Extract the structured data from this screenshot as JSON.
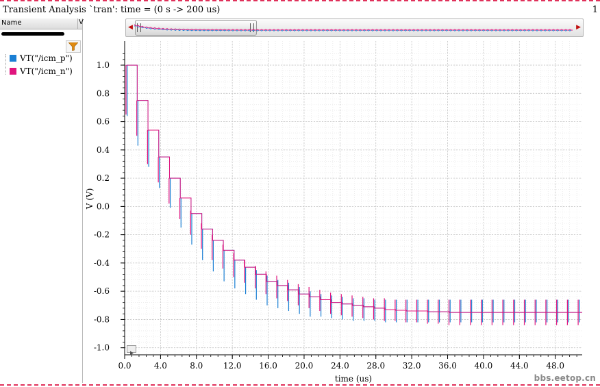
{
  "window": {
    "title": "Transient Analysis `tran': time = (0 s -> 200 us)",
    "page_number": "1"
  },
  "panel": {
    "header_name": "Name",
    "header_col2": "V"
  },
  "icons": {
    "filter": "filter-funnel-icon",
    "play": "play-triangle-icon"
  },
  "watermark": "bbs.eetop.cn",
  "colors": {
    "series_p": "#1a7fd4",
    "series_n": "#e0147e",
    "grid": "#c9c9c9",
    "border_dash": "#e0305a"
  },
  "chart_data": {
    "type": "line",
    "xlabel": "time (us)",
    "ylabel": "V (V)",
    "xlim": [
      0,
      51
    ],
    "ylim": [
      -1.05,
      1.17
    ],
    "xticks": [
      "0.0",
      "4.0",
      "8.0",
      "12.0",
      "16.0",
      "20.0",
      "24.0",
      "28.0",
      "32.0",
      "36.0",
      "40.0",
      "44.0",
      "48.0"
    ],
    "yticks": [
      "1.0",
      "0.8",
      "0.6",
      "0.4",
      "0.2",
      "0.0",
      "-0.2",
      "-0.4",
      "-0.6",
      "-0.8",
      "-1.0"
    ],
    "grid": true,
    "legend_position": "left-panel",
    "step_period_us": 1.2,
    "steady_state_v": -0.75,
    "series": [
      {
        "name": "VT(\"/icm_p\")",
        "color": "#1a7fd4",
        "x": [
          0.2,
          1.4,
          2.6,
          3.8,
          5.0,
          6.2,
          7.4,
          8.6,
          9.8,
          11.0,
          12.2,
          13.4,
          14.6,
          15.8,
          17.0,
          18.2,
          19.4,
          20.6,
          21.8,
          23.0,
          24.2,
          25.4,
          26.6,
          27.8,
          29.0,
          30.2,
          31.4,
          32.6,
          33.8,
          35.0,
          36.2,
          37.4,
          38.6,
          39.8,
          41.0,
          42.2,
          43.4,
          44.6,
          45.8,
          47.0,
          48.2,
          49.4,
          50.6
        ],
        "y": [
          1.0,
          0.75,
          0.54,
          0.35,
          0.2,
          0.06,
          -0.05,
          -0.16,
          -0.24,
          -0.31,
          -0.38,
          -0.43,
          -0.48,
          -0.53,
          -0.56,
          -0.59,
          -0.62,
          -0.64,
          -0.66,
          -0.68,
          -0.69,
          -0.7,
          -0.71,
          -0.72,
          -0.73,
          -0.735,
          -0.74,
          -0.74,
          -0.745,
          -0.745,
          -0.75,
          -0.75,
          -0.75,
          -0.75,
          -0.75,
          -0.75,
          -0.75,
          -0.75,
          -0.75,
          -0.75,
          -0.75,
          -0.75,
          -0.75
        ],
        "spike_low": [
          0.64,
          0.43,
          0.28,
          0.13,
          -0.01,
          -0.15,
          -0.27,
          -0.38,
          -0.46,
          -0.53,
          -0.58,
          -0.62,
          -0.66,
          -0.7,
          -0.72,
          -0.74,
          -0.76,
          -0.78,
          -0.78,
          -0.79,
          -0.8,
          -0.81,
          -0.81,
          -0.81,
          -0.82,
          -0.82,
          -0.82,
          -0.82,
          -0.82,
          -0.82,
          -0.82,
          -0.82,
          -0.82,
          -0.82,
          -0.82,
          -0.82,
          -0.82,
          -0.82,
          -0.82,
          -0.82,
          -0.82,
          -0.82,
          -0.82
        ],
        "spike_high": [
          1.0,
          0.75,
          0.54,
          0.35,
          0.2,
          0.06,
          -0.05,
          -0.16,
          -0.24,
          -0.31,
          -0.38,
          -0.43,
          -0.45,
          -0.49,
          -0.52,
          -0.54,
          -0.57,
          -0.6,
          -0.62,
          -0.63,
          -0.64,
          -0.65,
          -0.65,
          -0.66,
          -0.66,
          -0.66,
          -0.66,
          -0.66,
          -0.66,
          -0.66,
          -0.66,
          -0.66,
          -0.66,
          -0.66,
          -0.66,
          -0.66,
          -0.66,
          -0.66,
          -0.66,
          -0.66,
          -0.66,
          -0.66,
          -0.66
        ]
      },
      {
        "name": "VT(\"/icm_n\")",
        "color": "#e0147e",
        "x": [
          0.2,
          1.4,
          2.6,
          3.8,
          5.0,
          6.2,
          7.4,
          8.6,
          9.8,
          11.0,
          12.2,
          13.4,
          14.6,
          15.8,
          17.0,
          18.2,
          19.4,
          20.6,
          21.8,
          23.0,
          24.2,
          25.4,
          26.6,
          27.8,
          29.0,
          30.2,
          31.4,
          32.6,
          33.8,
          35.0,
          36.2,
          37.4,
          38.6,
          39.8,
          41.0,
          42.2,
          43.4,
          44.6,
          45.8,
          47.0,
          48.2,
          49.4,
          50.6
        ],
        "y": [
          1.0,
          0.75,
          0.54,
          0.35,
          0.2,
          0.06,
          -0.05,
          -0.16,
          -0.24,
          -0.31,
          -0.38,
          -0.43,
          -0.48,
          -0.53,
          -0.56,
          -0.59,
          -0.62,
          -0.64,
          -0.66,
          -0.68,
          -0.69,
          -0.7,
          -0.71,
          -0.72,
          -0.73,
          -0.735,
          -0.74,
          -0.74,
          -0.745,
          -0.745,
          -0.75,
          -0.75,
          -0.75,
          -0.75,
          -0.75,
          -0.75,
          -0.75,
          -0.75,
          -0.75,
          -0.75,
          -0.75,
          -0.75,
          -0.75
        ],
        "spike_low": [
          0.65,
          0.5,
          0.3,
          0.17,
          0.02,
          -0.09,
          -0.2,
          -0.3,
          -0.38,
          -0.44,
          -0.5,
          -0.54,
          -0.58,
          -0.62,
          -0.65,
          -0.67,
          -0.7,
          -0.72,
          -0.74,
          -0.76,
          -0.77,
          -0.78,
          -0.79,
          -0.8,
          -0.81,
          -0.81,
          -0.82,
          -0.82,
          -0.83,
          -0.83,
          -0.84,
          -0.84,
          -0.84,
          -0.84,
          -0.84,
          -0.84,
          -0.84,
          -0.84,
          -0.84,
          -0.84,
          -0.84,
          -0.84,
          -0.84
        ],
        "spike_high": [
          1.0,
          0.75,
          0.54,
          0.35,
          0.2,
          0.06,
          -0.03,
          -0.12,
          -0.2,
          -0.27,
          -0.33,
          -0.38,
          -0.42,
          -0.46,
          -0.49,
          -0.52,
          -0.55,
          -0.57,
          -0.59,
          -0.61,
          -0.62,
          -0.63,
          -0.64,
          -0.65,
          -0.65,
          -0.66,
          -0.66,
          -0.66,
          -0.66,
          -0.66,
          -0.66,
          -0.66,
          -0.66,
          -0.66,
          -0.66,
          -0.66,
          -0.66,
          -0.66,
          -0.66,
          -0.66,
          -0.66,
          -0.66,
          -0.66
        ]
      }
    ]
  }
}
